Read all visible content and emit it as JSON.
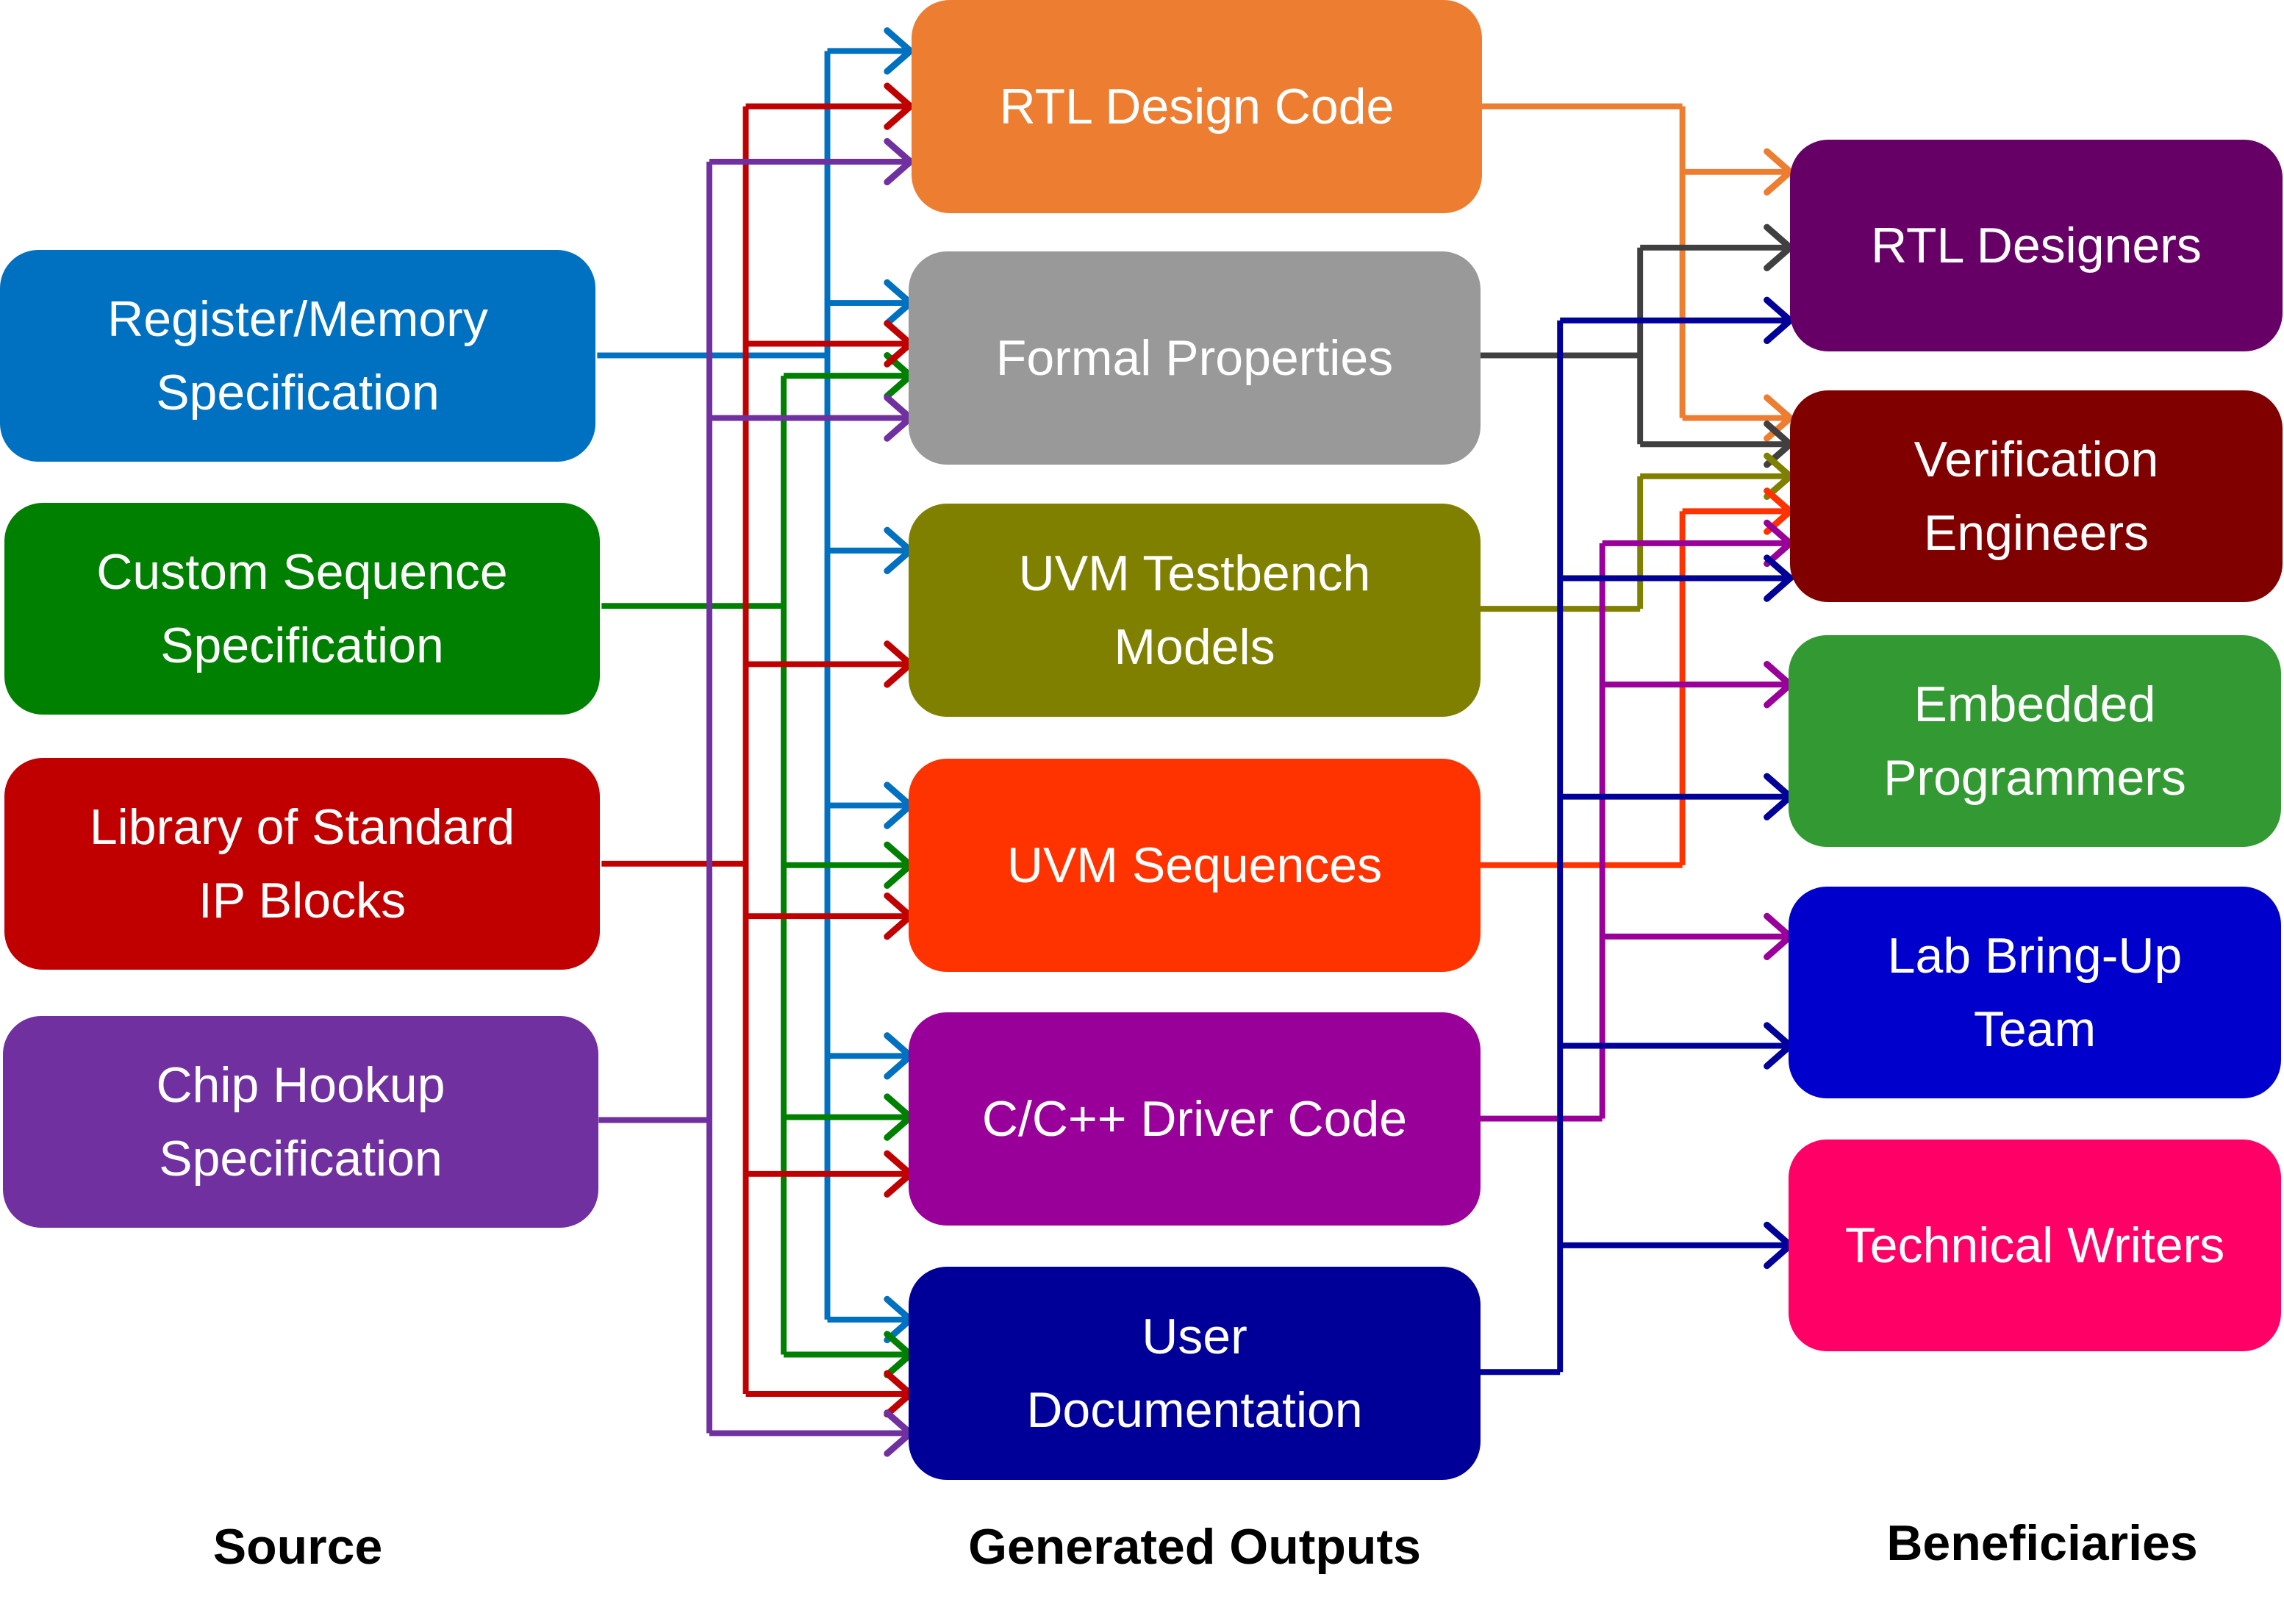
{
  "sources": [
    {
      "id": "regmem",
      "label": "Register/Memory\nSpecification",
      "color": "#0070C0"
    },
    {
      "id": "custseq",
      "label": "Custom Sequence\nSpecification",
      "color": "#008000"
    },
    {
      "id": "stdip",
      "label": "Library of Standard\nIP Blocks",
      "color": "#C00000"
    },
    {
      "id": "chiphook",
      "label": "Chip Hookup\nSpecification",
      "color": "#7030A0"
    }
  ],
  "outputs": [
    {
      "id": "rtl",
      "label": "RTL Design Code",
      "color": "#ED7D31"
    },
    {
      "id": "formal",
      "label": "Formal Properties",
      "color": "#999999"
    },
    {
      "id": "uvmtb",
      "label": "UVM Testbench\nModels",
      "color": "#808000"
    },
    {
      "id": "uvmseq",
      "label": "UVM Sequences",
      "color": "#FF3300"
    },
    {
      "id": "cdriver",
      "label": "C/C++ Driver Code",
      "color": "#990099"
    },
    {
      "id": "userdoc",
      "label": "User\nDocumentation",
      "color": "#000099"
    }
  ],
  "beneficiaries": [
    {
      "id": "rtldes",
      "label": "RTL Designers",
      "color": "#660066"
    },
    {
      "id": "verif",
      "label": "Verification\nEngineers",
      "color": "#800000"
    },
    {
      "id": "embed",
      "label": "Embedded\nProgrammers",
      "color": "#339933"
    },
    {
      "id": "lab",
      "label": "Lab Bring-Up\nTeam",
      "color": "#0000CC"
    },
    {
      "id": "techw",
      "label": "Technical Writers",
      "color": "#FF0066"
    }
  ],
  "column_labels": {
    "source": "Source",
    "outputs": "Generated Outputs",
    "beneficiaries": "Beneficiaries"
  },
  "wire_colors": {
    "formal_out": "#404040"
  },
  "connections": {
    "source_to_output": [
      {
        "from": "regmem",
        "to": [
          "rtl",
          "formal",
          "uvmtb",
          "uvmseq",
          "cdriver",
          "userdoc"
        ]
      },
      {
        "from": "custseq",
        "to": [
          "formal",
          "uvmseq",
          "cdriver",
          "userdoc"
        ]
      },
      {
        "from": "stdip",
        "to": [
          "rtl",
          "formal",
          "uvmtb",
          "uvmseq",
          "cdriver",
          "userdoc"
        ]
      },
      {
        "from": "chiphook",
        "to": [
          "rtl",
          "formal",
          "userdoc"
        ]
      }
    ],
    "output_to_beneficiary": [
      {
        "from": "rtl",
        "to": [
          "rtldes",
          "verif"
        ]
      },
      {
        "from": "formal",
        "to": [
          "rtldes",
          "verif"
        ]
      },
      {
        "from": "uvmtb",
        "to": [
          "verif"
        ]
      },
      {
        "from": "uvmseq",
        "to": [
          "verif"
        ]
      },
      {
        "from": "cdriver",
        "to": [
          "verif",
          "embed",
          "lab"
        ]
      },
      {
        "from": "userdoc",
        "to": [
          "rtldes",
          "verif",
          "embed",
          "lab",
          "techw"
        ]
      }
    ]
  }
}
